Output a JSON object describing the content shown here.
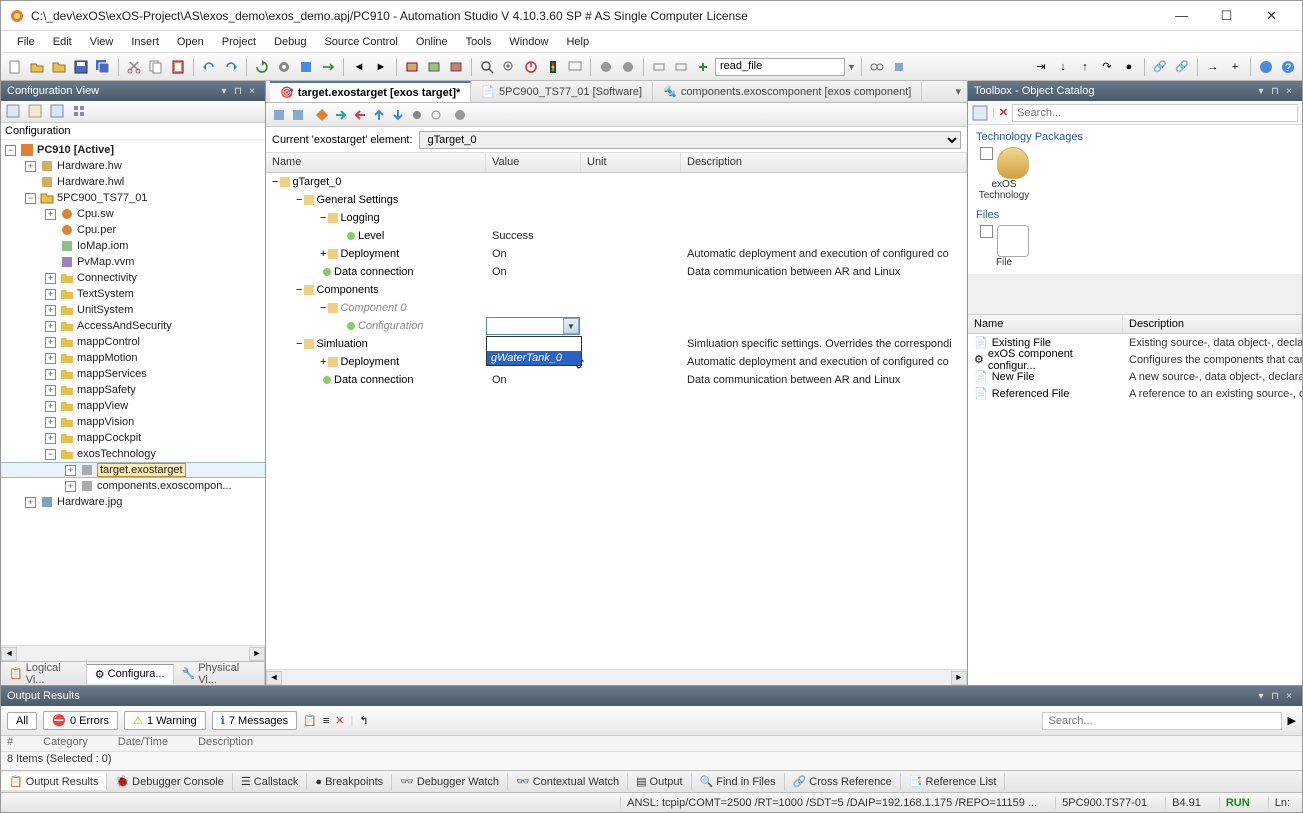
{
  "window": {
    "title": "C:\\_dev\\exOS\\exOS-Project\\AS\\exos_demo\\exos_demo.apj/PC910 - Automation Studio V 4.10.3.60 SP # AS Single Computer License"
  },
  "menu": [
    "File",
    "Edit",
    "View",
    "Insert",
    "Open",
    "Project",
    "Debug",
    "Source Control",
    "Online",
    "Tools",
    "Window",
    "Help"
  ],
  "toolbar_combo": "read_file",
  "left_panel": {
    "title": "Configuration View",
    "root_label": "Configuration",
    "root": "PC910 [Active]",
    "nodes": {
      "hw": "Hardware.hw",
      "hwl": "Hardware.hwl",
      "ts77": "5PC900_TS77_01",
      "cpu_sw": "Cpu.sw",
      "cpu_per": "Cpu.per",
      "iomap": "IoMap.iom",
      "pvmap": "PvMap.vvm",
      "connectivity": "Connectivity",
      "textsystem": "TextSystem",
      "unitsystem": "UnitSystem",
      "access": "AccessAndSecurity",
      "mappcontrol": "mappControl",
      "mappmotion": "mappMotion",
      "mappservices": "mappServices",
      "mappsafety": "mappSafety",
      "mappview": "mappView",
      "mappvision": "mappVision",
      "mappcockpit": "mappCockpit",
      "exostech": "exosTechnology",
      "target": "target.exostarget",
      "components": "components.exoscompon...",
      "hwjpg": "Hardware.jpg"
    },
    "bottom_tabs": {
      "logical": "Logical Vi...",
      "config": "Configura...",
      "physical": "Physical Vi..."
    }
  },
  "doc_tabs": {
    "t1": "target.exostarget [exos target]*",
    "t2": "5PC900_TS77_01 [Software]",
    "t3": "components.exoscomponent [exos component]"
  },
  "current_element_label": "Current 'exostarget' element:",
  "current_element_value": "gTarget_0",
  "grid": {
    "cols": {
      "name": "Name",
      "value": "Value",
      "unit": "Unit",
      "desc": "Description"
    },
    "rows": {
      "gtarget": "gTarget_0",
      "general": "General Settings",
      "logging": "Logging",
      "level": "Level",
      "level_val": "Success",
      "deployment": "Deployment",
      "deployment_val": "On",
      "deployment_desc": "Automatic deployment and execution of configured co",
      "dataconn": "Data connection",
      "dataconn_val": "On",
      "dataconn_desc": "Data communication between AR and Linux",
      "components": "Components",
      "component0": "Component 0",
      "configuration": "Configuration",
      "simulation": "Simluation",
      "simulation_desc": "Simluation specific settings. Overrides the correspondi",
      "sim_deployment": "Deployment",
      "sim_deployment_desc": "Automatic deployment and execution of configured co",
      "sim_dataconn": "Data connection",
      "sim_dataconn_val": "On",
      "sim_dataconn_desc": "Data communication between AR and Linux"
    },
    "dropdown_option": "gWaterTank_0"
  },
  "right_panel": {
    "title": "Toolbox - Object Catalog",
    "search_ph": "Search...",
    "tech_pkg": "Technology Packages",
    "exos_label": "exOS Technology",
    "files_label": "Files",
    "file_label": "File",
    "flcols": {
      "name": "Name",
      "desc": "Description"
    },
    "files": [
      {
        "n": "Existing File",
        "d": "Existing source-, data object-, declara"
      },
      {
        "n": "exOS component configur...",
        "d": "Configures the components that can "
      },
      {
        "n": "New File",
        "d": "A new source-, data object-, declarati"
      },
      {
        "n": "Referenced File",
        "d": "A reference to an existing source-, da"
      }
    ]
  },
  "output": {
    "title": "Output Results",
    "all": "All",
    "errors": "0 Errors",
    "warnings": "1 Warning",
    "messages": "7 Messages",
    "search_ph": "Search...",
    "hdr": {
      "num": "#",
      "cat": "Category",
      "dt": "Date/Time",
      "desc": "Description"
    },
    "status": "8 Items (Selected : 0)"
  },
  "bottom_tabs": [
    "Output Results",
    "Debugger Console",
    "Callstack",
    "Breakpoints",
    "Debugger Watch",
    "Contextual Watch",
    "Output",
    "Find in Files",
    "Cross Reference",
    "Reference List"
  ],
  "statusbar": {
    "ansl": "ANSL: tcpip/COMT=2500 /RT=1000 /SDT=5 /DAIP=192.168.1.175 /REPO=11159 ...",
    "target": "5PC900.TS77-01",
    "ver": "B4.91",
    "run": "RUN",
    "ln": "Ln:"
  }
}
